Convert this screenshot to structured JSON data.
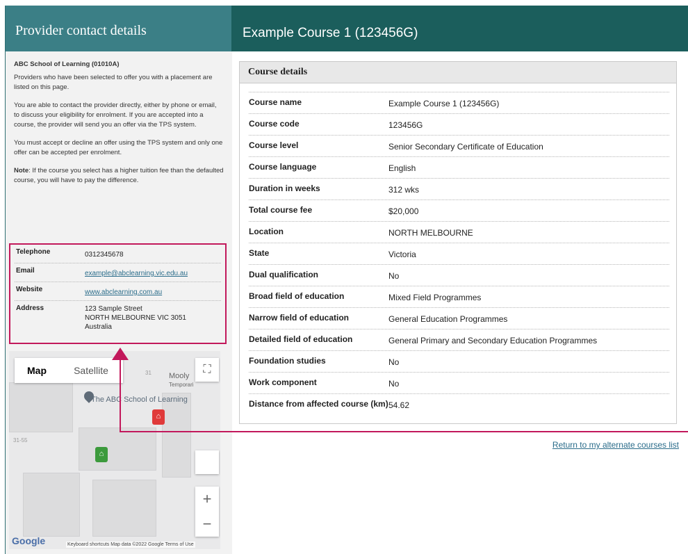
{
  "sidebar": {
    "title": "Provider contact details",
    "provider_name": "ABC School of Learning (01010A)",
    "paragraphs": [
      "Providers who have been selected to offer you with a placement are listed on this page.",
      "You are able to contact the provider directly, either by phone or email, to discuss your eligibility for enrolment. If you are accepted into a course, the provider will send you an offer via the TPS system.",
      "You must accept or decline an offer using the TPS system and only one offer can be accepted per enrolment."
    ],
    "note_label": "Note",
    "note_text": ": If the course you select has a higher tuition fee than the defaulted course, you will have to pay the difference.",
    "contact": {
      "telephone_label": "Telephone",
      "telephone": "0312345678",
      "email_label": "Email",
      "email": "example@abclearning.vic.edu.au",
      "website_label": "Website",
      "website": "www.abclearning.com.au",
      "address_label": "Address",
      "address_line1": "123 Sample Street",
      "address_line2": "NORTH MELBOURNE VIC 3051",
      "address_line3": "Australia"
    }
  },
  "map": {
    "tab_map": "Map",
    "tab_satellite": "Satellite",
    "place_label": "The ABC School of Learning",
    "street_label": "Mooly",
    "street_sub": "Temporari",
    "num_31": "31",
    "num_3155": "31-55",
    "zoom_in": "+",
    "zoom_out": "−",
    "google": "Google",
    "footer": "Keyboard shortcuts   Map data ©2022 Google   Terms of Use"
  },
  "course": {
    "header_title": "Example Course 1 (123456G)",
    "panel_title": "Course details",
    "rows": [
      {
        "label": "Course name",
        "value": "Example Course 1 (123456G)"
      },
      {
        "label": "Course code",
        "value": "123456G"
      },
      {
        "label": "Course level",
        "value": "Senior Secondary Certificate of Education"
      },
      {
        "label": "Course language",
        "value": "English"
      },
      {
        "label": "Duration in weeks",
        "value": "312 wks"
      },
      {
        "label": "Total course fee",
        "value": "$20,000"
      },
      {
        "label": "Location",
        "value": "NORTH MELBOURNE"
      },
      {
        "label": "State",
        "value": "Victoria"
      },
      {
        "label": "Dual qualification",
        "value": "No"
      },
      {
        "label": "Broad field of education",
        "value": "Mixed Field Programmes"
      },
      {
        "label": "Narrow field of education",
        "value": "General Education Programmes"
      },
      {
        "label": "Detailed field of education",
        "value": "General Primary and Secondary Education Programmes"
      },
      {
        "label": "Foundation studies",
        "value": "No"
      },
      {
        "label": "Work component",
        "value": "No"
      },
      {
        "label": "Distance from affected course (km)",
        "value": "54.62"
      }
    ],
    "return_link": "Return to my alternate courses list"
  },
  "colors": {
    "sidebar_header": "#3b7f86",
    "main_header": "#1b5e5c",
    "annotation": "#c2185b",
    "link": "#2a6c8a"
  }
}
